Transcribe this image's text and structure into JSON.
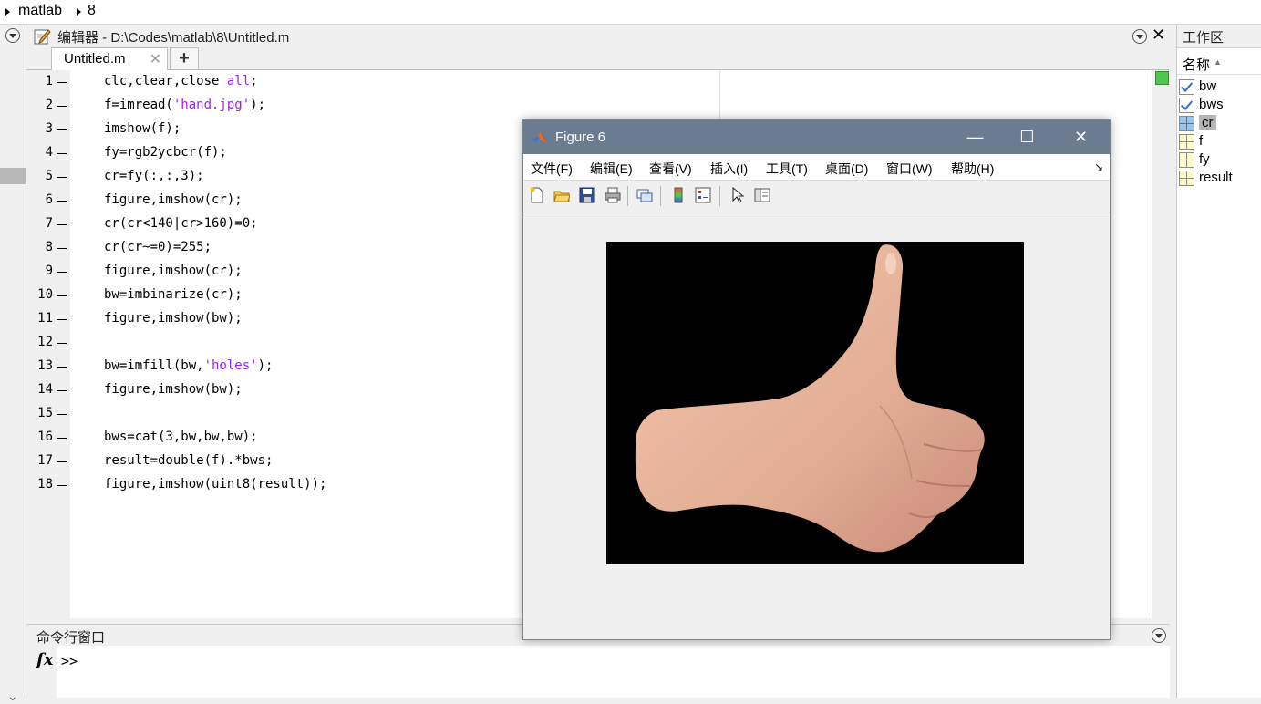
{
  "breadcrumb": {
    "items": [
      "matlab",
      "8"
    ]
  },
  "editor": {
    "title": "编辑器 - D:\\Codes\\matlab\\8\\Untitled.m",
    "tab_label": "Untitled.m",
    "tab_close": "✕",
    "new_tab": "+",
    "lines": [
      {
        "n": "1",
        "code": "clc,clear,close ",
        "str": "all",
        "tail": ";"
      },
      {
        "n": "2",
        "code": "f=imread(",
        "str": "'hand.jpg'",
        "tail": ");"
      },
      {
        "n": "3",
        "code": "imshow(f);",
        "str": "",
        "tail": ""
      },
      {
        "n": "4",
        "code": "fy=rgb2ycbcr(f);",
        "str": "",
        "tail": ""
      },
      {
        "n": "5",
        "code": "cr=fy(:,:,3);",
        "str": "",
        "tail": ""
      },
      {
        "n": "6",
        "code": "figure,imshow(cr);",
        "str": "",
        "tail": ""
      },
      {
        "n": "7",
        "code": "cr(cr<140|cr>160)=0;",
        "str": "",
        "tail": ""
      },
      {
        "n": "8",
        "code": "cr(cr~=0)=255;",
        "str": "",
        "tail": ""
      },
      {
        "n": "9",
        "code": "figure,imshow(cr);",
        "str": "",
        "tail": ""
      },
      {
        "n": "10",
        "code": "bw=imbinarize(cr);",
        "str": "",
        "tail": ""
      },
      {
        "n": "11",
        "code": "figure,imshow(bw);",
        "str": "",
        "tail": ""
      },
      {
        "n": "12",
        "code": "",
        "str": "",
        "tail": ""
      },
      {
        "n": "13",
        "code": "bw=imfill(bw,",
        "str": "'holes'",
        "tail": ");"
      },
      {
        "n": "14",
        "code": "figure,imshow(bw);",
        "str": "",
        "tail": ""
      },
      {
        "n": "15",
        "code": "",
        "str": "",
        "tail": ""
      },
      {
        "n": "16",
        "code": "bws=cat(3,bw,bw,bw);",
        "str": "",
        "tail": ""
      },
      {
        "n": "17",
        "code": "result=double(f).*bws;",
        "str": "",
        "tail": ""
      },
      {
        "n": "18",
        "code": "figure,imshow(uint8(result));",
        "str": "",
        "tail": ""
      }
    ]
  },
  "command_window": {
    "title": "命令行窗口",
    "fx": "fx",
    "prompt": ">>"
  },
  "workspace": {
    "title": "工作区",
    "column_header": "名称",
    "sort_indicator": "▲",
    "vars": [
      {
        "name": "bw",
        "icon": "checkbox-icon"
      },
      {
        "name": "bws",
        "icon": "checkbox-icon"
      },
      {
        "name": "cr",
        "icon": "matrix-icon",
        "selected": true
      },
      {
        "name": "f",
        "icon": "matrix-icon"
      },
      {
        "name": "fy",
        "icon": "matrix-icon"
      },
      {
        "name": "result",
        "icon": "matrix-icon"
      }
    ]
  },
  "figure": {
    "title": "Figure 6",
    "minimize": "—",
    "maximize": "☐",
    "close": "✕",
    "menu": [
      "文件(F)",
      "编辑(E)",
      "查看(V)",
      "插入(I)",
      "工具(T)",
      "桌面(D)",
      "窗口(W)",
      "帮助(H)"
    ],
    "menu_dock": "↘",
    "toolbar": [
      "new-file-icon",
      "open-folder-icon",
      "save-icon",
      "print-icon",
      "link-plot-icon",
      "colorbar-icon",
      "legend-icon",
      "pointer-icon",
      "property-inspector-icon"
    ]
  },
  "colors": {
    "figure_titlebar": "#6b7b90",
    "string": "#a020f0",
    "skin": "#e6b79f"
  }
}
